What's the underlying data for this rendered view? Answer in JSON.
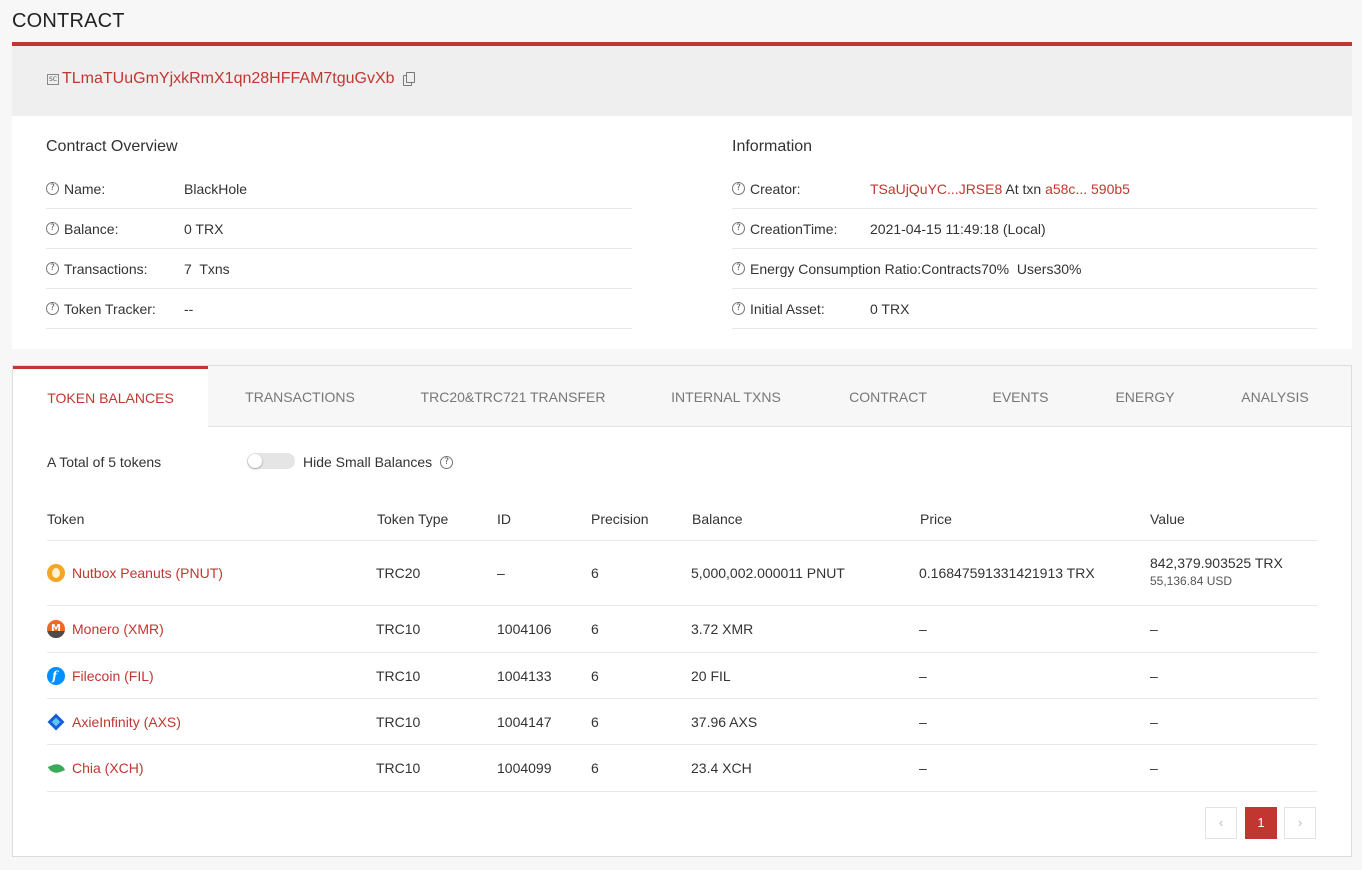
{
  "page_title": "CONTRACT",
  "contract_address": "TLmaTUuGmYjxkRmX1qn28HFFAM7tguGvXb",
  "sc_badge": "SC",
  "overview": {
    "heading": "Contract Overview",
    "rows": [
      {
        "label": "Name:",
        "value": "BlackHole"
      },
      {
        "label": "Balance:",
        "value": "0 TRX"
      },
      {
        "label": "Transactions:",
        "value": "7  Txns"
      },
      {
        "label": "Token Tracker:",
        "value": "--"
      }
    ]
  },
  "information": {
    "heading": "Information",
    "creator_label": "Creator:",
    "creator_address": "TSaUjQuYC...JRSE8",
    "creator_at_txn": "At txn",
    "creator_txn": "a58c... 590b5",
    "creation_time_label": "CreationTime:",
    "creation_time_value": "2021-04-15 11:49:18 (Local)",
    "energy_label": "Energy Consumption Ratio:",
    "energy_value": "Contracts70%  Users30%",
    "initial_asset_label": "Initial Asset:",
    "initial_asset_value": "0 TRX"
  },
  "tabs": [
    {
      "label": "TOKEN BALANCES",
      "active": true
    },
    {
      "label": "TRANSACTIONS"
    },
    {
      "label": "TRC20&TRC721 TRANSFER"
    },
    {
      "label": "INTERNAL TXNS"
    },
    {
      "label": "CONTRACT"
    },
    {
      "label": "EVENTS"
    },
    {
      "label": "ENERGY"
    },
    {
      "label": "ANALYSIS"
    }
  ],
  "token_summary": "A Total of 5 tokens",
  "hide_small_label": "Hide Small Balances",
  "table": {
    "headers": [
      "Token",
      "Token Type",
      "ID",
      "Precision",
      "Balance",
      "Price",
      "Value"
    ],
    "rows": [
      {
        "token": "Nutbox Peanuts (PNUT)",
        "icon": "peanut-icon",
        "type": "TRC20",
        "id": "–",
        "precision": "6",
        "balance": "5,000,002.000011 PNUT",
        "price": "0.16847591331421913 TRX",
        "value": "842,379.903525 TRX",
        "value_usd": "55,136.84 USD"
      },
      {
        "token": "Monero (XMR)",
        "icon": "monero-icon",
        "type": "TRC10",
        "id": "1004106",
        "precision": "6",
        "balance": "3.72 XMR",
        "price": "–",
        "value": "–"
      },
      {
        "token": "Filecoin (FIL)",
        "icon": "filecoin-icon",
        "type": "TRC10",
        "id": "1004133",
        "precision": "6",
        "balance": "20 FIL",
        "price": "–",
        "value": "–"
      },
      {
        "token": "AxieInfinity (AXS)",
        "icon": "axie-icon",
        "type": "TRC10",
        "id": "1004147",
        "precision": "6",
        "balance": "37.96 AXS",
        "price": "–",
        "value": "–"
      },
      {
        "token": "Chia (XCH)",
        "icon": "chia-icon",
        "type": "TRC10",
        "id": "1004099",
        "precision": "6",
        "balance": "23.4 XCH",
        "price": "–",
        "value": "–"
      }
    ]
  },
  "pagination": {
    "prev": "‹",
    "current": "1",
    "next": "›"
  },
  "colors": {
    "accent": "#c23631"
  }
}
